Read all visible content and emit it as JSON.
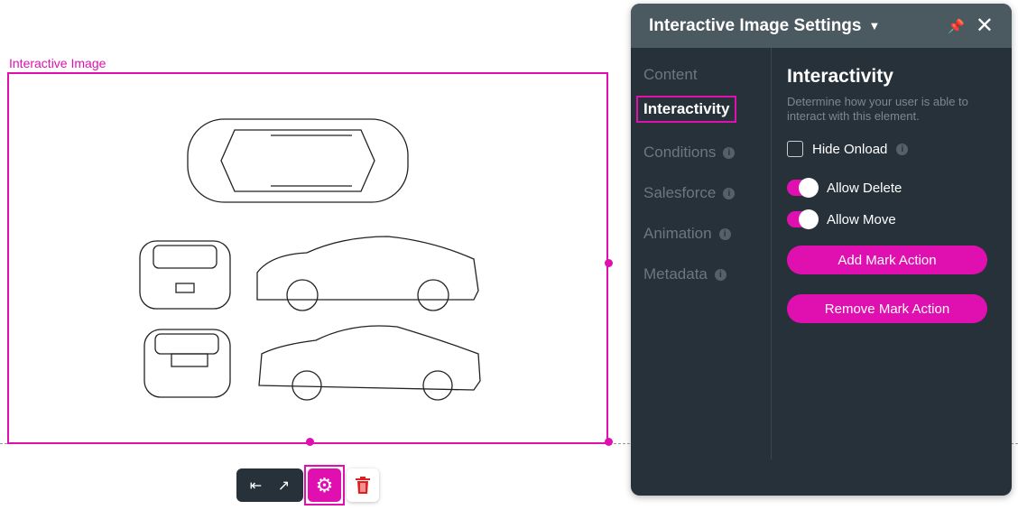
{
  "canvas": {
    "element_label": "Interactive Image",
    "accent": "#e010b0"
  },
  "toolbar": {
    "collapse_icon": "⇤",
    "open_icon": "↗",
    "settings_icon": "⚙"
  },
  "panel": {
    "title": "Interactive Image Settings",
    "nav": [
      {
        "label": "Content"
      },
      {
        "label": "Interactivity"
      },
      {
        "label": "Conditions"
      },
      {
        "label": "Salesforce"
      },
      {
        "label": "Animation"
      },
      {
        "label": "Metadata"
      }
    ],
    "section_title": "Interactivity",
    "description": "Determine how your user is able to interact with this element.",
    "hide_onload": {
      "label": "Hide Onload",
      "checked": false
    },
    "allow_delete": {
      "label": "Allow Delete",
      "on": true
    },
    "allow_move": {
      "label": "Allow Move",
      "on": true
    },
    "add_mark_action": "Add Mark Action",
    "remove_mark_action": "Remove Mark Action",
    "info_glyph": "i"
  }
}
